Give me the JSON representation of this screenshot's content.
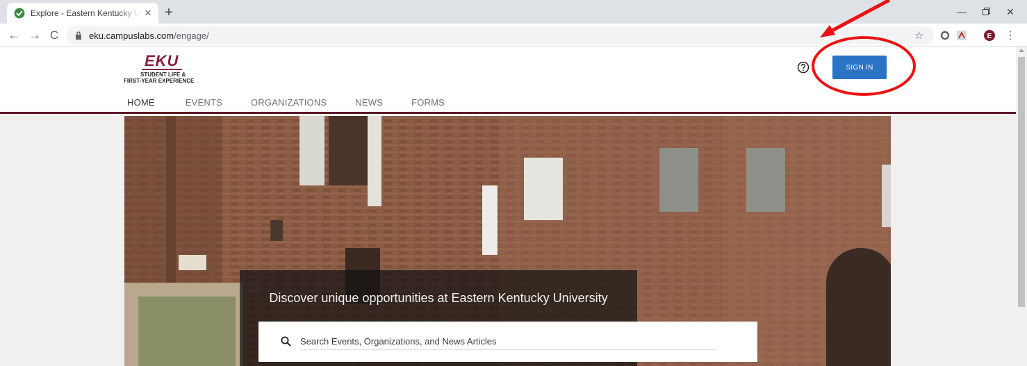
{
  "browser": {
    "tab_title": "Explore - Eastern Kentucky Unive",
    "url_host": "eku.campuslabs.com",
    "url_path": "/engage/",
    "window_controls": [
      "minimize-icon",
      "restore-icon",
      "close-icon"
    ]
  },
  "header": {
    "logo_text": "EKU",
    "logo_sub1": "STUDENT LIFE &",
    "logo_sub2": "FIRST-YEAR EXPERIENCE",
    "signin_label": "SIGN IN"
  },
  "nav": {
    "items": [
      "HOME",
      "EVENTS",
      "ORGANIZATIONS",
      "NEWS",
      "FORMS"
    ],
    "active": "HOME"
  },
  "hero": {
    "heading": "Discover unique opportunities at Eastern Kentucky University",
    "search_placeholder": "Search Events, Organizations, and News Articles"
  },
  "colors": {
    "brand": "#861f41",
    "header_border": "#5a1a24",
    "signin_button": "#2a73c5",
    "annotation": "#ee1111"
  }
}
